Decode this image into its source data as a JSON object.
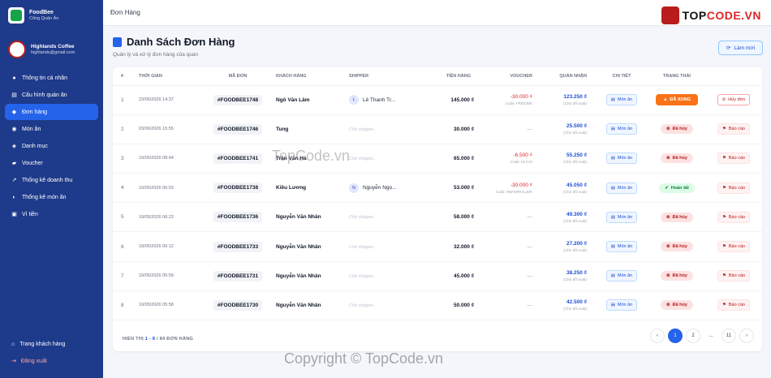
{
  "app": {
    "name": "FoodBee",
    "subtitle": "Cổng Quản Ăn"
  },
  "store": {
    "name": "Highlands Coffee",
    "email": "highlands@gmail.com"
  },
  "sidebar": {
    "items": [
      {
        "label": "Thông tin cá nhân",
        "icon": "user-icon"
      },
      {
        "label": "Cấu hình quán ăn",
        "icon": "store-icon"
      },
      {
        "label": "Đơn hàng",
        "icon": "bag-icon",
        "active": true
      },
      {
        "label": "Món ăn",
        "icon": "dish-icon"
      },
      {
        "label": "Danh mục",
        "icon": "tag-icon"
      },
      {
        "label": "Voucher",
        "icon": "ticket-icon"
      },
      {
        "label": "Thống kê doanh thu",
        "icon": "chart-icon"
      },
      {
        "label": "Thống kê món ăn",
        "icon": "pie-icon"
      },
      {
        "label": "Ví tiền",
        "icon": "wallet-icon"
      }
    ],
    "bottom": [
      {
        "label": "Trang khách hàng",
        "icon": "home-icon"
      },
      {
        "label": "Đăng xuất",
        "icon": "logout-icon"
      }
    ]
  },
  "topbar": {
    "title": "Đơn Hàng",
    "watermark_logo_a": "TOP",
    "watermark_logo_b": "CODE.VN"
  },
  "page": {
    "title": "Danh Sách Đơn Hàng",
    "subtitle": "Quản lý và xử lý đơn hàng của quán",
    "refresh_label": "Làm mới"
  },
  "table": {
    "headers": [
      "#",
      "THỜI GIAN",
      "MÃ ĐƠN",
      "KHÁCH HÀNG",
      "SHIPPER",
      "TIỀN HÀNG",
      "VOUCHER",
      "QUÁN NHẬN",
      "CHI TIẾT",
      "TRẠNG THÁI"
    ],
    "dish_label": "Món ăn",
    "shipper_placeholder": "Chờ shipper...",
    "receive_note": "(Chờ đối soát)",
    "rows": [
      {
        "idx": "1",
        "time": "23/06/2026 14:37",
        "code": "#FOODBEE1748",
        "customer": "Ngô Văn Lâm",
        "shipper": "Lê Thanh Tr...",
        "shipper_initial": "L",
        "amount": "145.000 ₫",
        "voucher": "-30.000 ₫",
        "voucher_code": "Code: FREE30K",
        "receive": "123.250 ₫",
        "status": "ĐÃ XONG",
        "status_type": "ready",
        "action": "Hủy đơn",
        "action_type": "cancel"
      },
      {
        "idx": "2",
        "time": "03/06/2026 15:55",
        "code": "#FOODBEE1746",
        "customer": "Tung",
        "shipper": "",
        "shipper_initial": "",
        "amount": "30.000 ₫",
        "voucher": "—",
        "voucher_code": "",
        "receive": "25.500 ₫",
        "status": "Đã hủy",
        "status_type": "cancel",
        "action": "Báo cáo",
        "action_type": "report"
      },
      {
        "idx": "3",
        "time": "19/05/2026 08:44",
        "code": "#FOODBEE1741",
        "customer": "Trần Văn Hà",
        "shipper": "",
        "shipper_initial": "",
        "amount": "65.000 ₫",
        "voucher": "-6.500 ₫",
        "voucher_code": "Code: HLC10",
        "receive": "55.250 ₫",
        "status": "Đã hủy",
        "status_type": "cancel",
        "action": "Báo cáo",
        "action_type": "report"
      },
      {
        "idx": "4",
        "time": "19/05/2026 06:53",
        "code": "#FOODBEE1738",
        "customer": "Kiều Lương",
        "shipper": "Nguyễn Ngọ...",
        "shipper_initial": "N",
        "amount": "53.000 ₫",
        "voucher": "-30.000 ₫",
        "voucher_code": "Code: REFERRAL30K",
        "receive": "45.050 ₫",
        "status": "Hoàn tất",
        "status_type": "done",
        "action": "Báo cáo",
        "action_type": "report"
      },
      {
        "idx": "5",
        "time": "19/05/2026 06:23",
        "code": "#FOODBEE1736",
        "customer": "Nguyễn Văn Nhân",
        "shipper": "",
        "shipper_initial": "",
        "amount": "58.000 ₫",
        "voucher": "—",
        "voucher_code": "",
        "receive": "49.300 ₫",
        "status": "Đã hủy",
        "status_type": "cancel",
        "action": "Báo cáo",
        "action_type": "report"
      },
      {
        "idx": "6",
        "time": "19/05/2026 06:12",
        "code": "#FOODBEE1733",
        "customer": "Nguyễn Văn Nhân",
        "shipper": "",
        "shipper_initial": "",
        "amount": "32.000 ₫",
        "voucher": "—",
        "voucher_code": "",
        "receive": "27.200 ₫",
        "status": "Đã hủy",
        "status_type": "cancel",
        "action": "Báo cáo",
        "action_type": "report"
      },
      {
        "idx": "7",
        "time": "19/05/2026 05:59",
        "code": "#FOODBEE1731",
        "customer": "Nguyễn Văn Nhân",
        "shipper": "",
        "shipper_initial": "",
        "amount": "45.000 ₫",
        "voucher": "—",
        "voucher_code": "",
        "receive": "38.250 ₫",
        "status": "Đã hủy",
        "status_type": "cancel",
        "action": "Báo cáo",
        "action_type": "report"
      },
      {
        "idx": "8",
        "time": "19/05/2026 05:58",
        "code": "#FOODBEE1730",
        "customer": "Nguyễn Văn Nhân",
        "shipper": "",
        "shipper_initial": "",
        "amount": "50.000 ₫",
        "voucher": "—",
        "voucher_code": "",
        "receive": "42.500 ₫",
        "status": "Đã hủy",
        "status_type": "cancel",
        "action": "Báo cáo",
        "action_type": "report"
      }
    ]
  },
  "footer": {
    "prefix": "HIỂN THỊ",
    "range": "1 - 8",
    "total": "/ 84 ĐƠN HÀNG"
  },
  "pagination": {
    "pages": [
      "1",
      "2",
      "...",
      "11"
    ],
    "active": "1"
  },
  "watermarks": {
    "middle": "TopCode.vn",
    "bottom": "Copyright © TopCode.vn"
  },
  "colors": {
    "sidebar": "#1e3a8a",
    "accent": "#2563eb",
    "danger": "#b91c1c",
    "success": "#15803d",
    "warning": "#f97316"
  }
}
